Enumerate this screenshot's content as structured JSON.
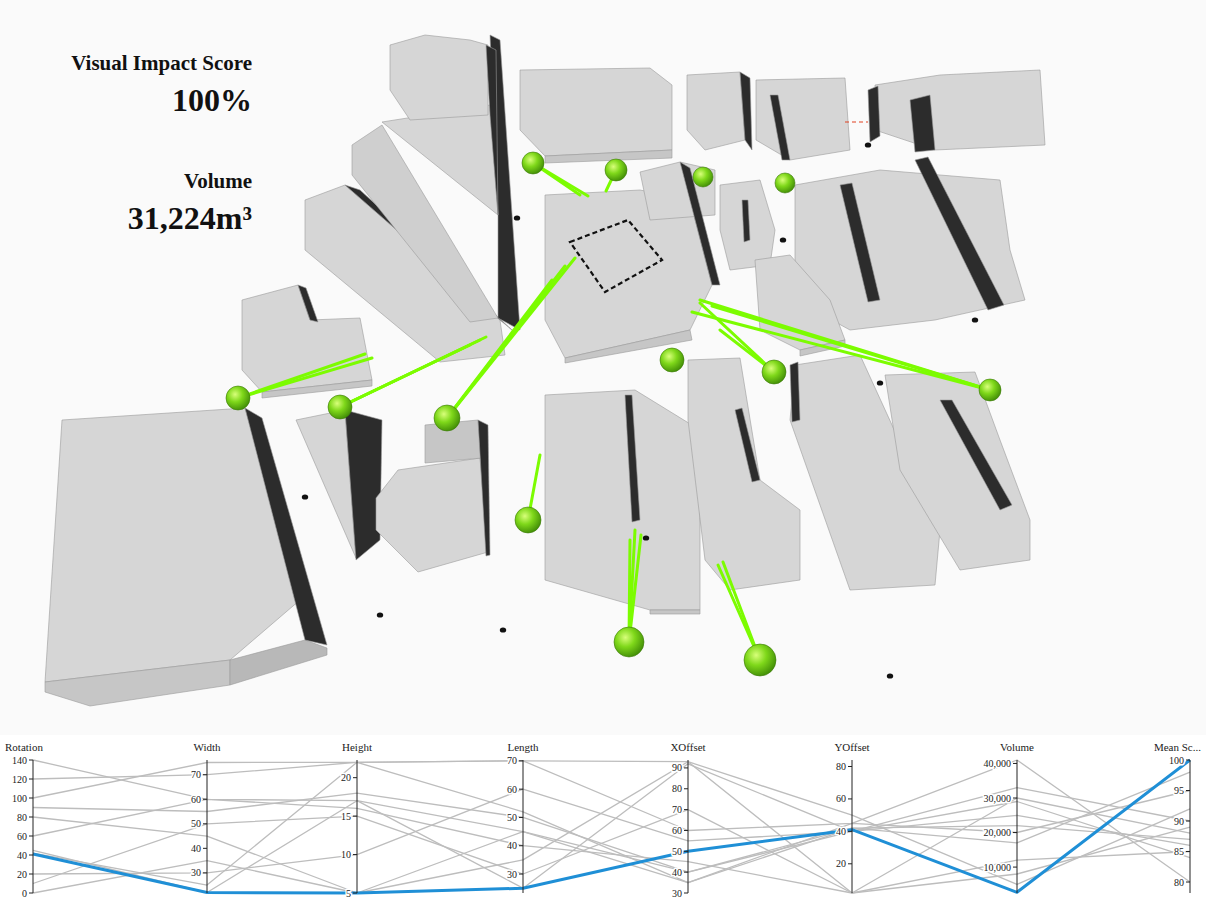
{
  "metrics": [
    {
      "label": "Visual Impact Score",
      "value": "100%"
    },
    {
      "label": "Volume",
      "value": "31,224m³"
    }
  ],
  "chart": {
    "axes": [
      {
        "label": "Rotation",
        "min": 0,
        "max": 140,
        "ticks": [
          {
            "label": "0",
            "value": 0
          },
          {
            "label": "20",
            "value": 20
          },
          {
            "label": "40",
            "value": 40
          },
          {
            "label": "60",
            "value": 60
          },
          {
            "label": "80",
            "value": 80
          },
          {
            "label": "100",
            "value": 100
          },
          {
            "label": "120",
            "value": 120
          },
          {
            "label": "140",
            "value": 140
          }
        ]
      },
      {
        "label": "Width",
        "min": 21.8,
        "max": 76,
        "ticks": [
          {
            "label": "30",
            "value": 30
          },
          {
            "label": "40",
            "value": 40
          },
          {
            "label": "50",
            "value": 50
          },
          {
            "label": "60",
            "value": 60
          },
          {
            "label": "70",
            "value": 70
          }
        ]
      },
      {
        "label": "Height",
        "min": 5,
        "max": 22.3,
        "ticks": [
          {
            "label": "5",
            "value": 5
          },
          {
            "label": "10",
            "value": 10
          },
          {
            "label": "15",
            "value": 15
          },
          {
            "label": "20",
            "value": 20
          }
        ]
      },
      {
        "label": "Length",
        "min": 23.3,
        "max": 70.3,
        "ticks": [
          {
            "label": "30",
            "value": 30
          },
          {
            "label": "40",
            "value": 40
          },
          {
            "label": "50",
            "value": 50
          },
          {
            "label": "60",
            "value": 60
          },
          {
            "label": "70",
            "value": 70
          }
        ]
      },
      {
        "label": "XOffset",
        "min": 30,
        "max": 93.8,
        "ticks": [
          {
            "label": "30",
            "value": 30
          },
          {
            "label": "40",
            "value": 40
          },
          {
            "label": "50",
            "value": 50
          },
          {
            "label": "60",
            "value": 60
          },
          {
            "label": "70",
            "value": 70
          },
          {
            "label": "80",
            "value": 80
          },
          {
            "label": "90",
            "value": 90
          }
        ]
      },
      {
        "label": "YOffset",
        "min": 2,
        "max": 84,
        "ticks": [
          {
            "label": "20",
            "value": 20
          },
          {
            "label": "40",
            "value": 40
          },
          {
            "label": "60",
            "value": 60
          },
          {
            "label": "80",
            "value": 80
          }
        ]
      },
      {
        "label": "Volume",
        "min": 2500,
        "max": 41000,
        "ticks": [
          {
            "label": "10,000",
            "value": 10000
          },
          {
            "label": "20,000",
            "value": 20000
          },
          {
            "label": "30,000",
            "value": 30000
          },
          {
            "label": "40,000",
            "value": 40000
          }
        ]
      },
      {
        "label": "Mean Sc...",
        "min": 78.2,
        "max": 100,
        "ticks": [
          {
            "label": "80",
            "value": 80
          },
          {
            "label": "85",
            "value": 85
          },
          {
            "label": "90",
            "value": 90
          },
          {
            "label": "95",
            "value": 95
          },
          {
            "label": "100",
            "value": 100
          }
        ]
      }
    ],
    "series": [
      {
        "values": [
          140,
          60,
          17,
          45,
          35,
          42,
          22000,
          87
        ],
        "selected": false
      },
      {
        "values": [
          120,
          70,
          22,
          70,
          93,
          2,
          12000,
          85
        ],
        "selected": false
      },
      {
        "values": [
          100,
          75,
          22,
          70,
          60,
          45,
          41000,
          80
        ],
        "selected": false
      },
      {
        "values": [
          90,
          55,
          18,
          50,
          40,
          40,
          33000,
          90
        ],
        "selected": false
      },
      {
        "values": [
          80,
          45,
          5,
          35,
          93,
          50,
          5000,
          92
        ],
        "selected": false
      },
      {
        "values": [
          60,
          60,
          16,
          40,
          45,
          2,
          30000,
          88
        ],
        "selected": false
      },
      {
        "values": [
          42,
          25,
          22,
          52,
          35,
          45,
          20000,
          95
        ],
        "selected": false
      },
      {
        "values": [
          20,
          30,
          10,
          60,
          55,
          40,
          25000,
          86
        ],
        "selected": false
      },
      {
        "values": [
          10,
          50,
          15,
          30,
          70,
          2,
          8000,
          89
        ],
        "selected": false
      },
      {
        "values": [
          0,
          35,
          5,
          45,
          40,
          42,
          17000,
          98
        ],
        "selected": false
      },
      {
        "values": [
          45,
          22,
          17,
          25,
          92,
          40,
          29000,
          84
        ],
        "selected": false
      },
      {
        "values": [
          41,
          22,
          5,
          25,
          50,
          41,
          2700,
          100
        ],
        "selected": true
      }
    ]
  }
}
